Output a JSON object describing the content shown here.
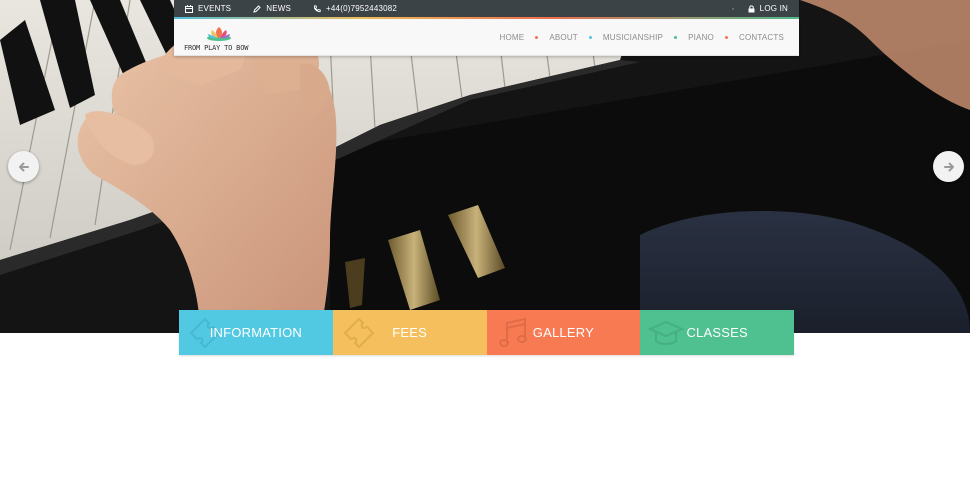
{
  "topbar": {
    "events": "EVENTS",
    "news": "NEWS",
    "phone": "+44(0)7952443082",
    "login": "LOG IN"
  },
  "logo": {
    "text": "FROM PLAY TO BOW"
  },
  "nav": {
    "items": [
      {
        "label": "HOME",
        "dot_color": "#f47351"
      },
      {
        "label": "ABOUT",
        "dot_color": "#51c4e0"
      },
      {
        "label": "MUSICIANSHIP",
        "dot_color": "#4fbf8e"
      },
      {
        "label": "PIANO",
        "dot_color": "#f47351"
      },
      {
        "label": "CONTACTS"
      }
    ]
  },
  "slider": {
    "prev_icon": "arrow-left-icon",
    "next_icon": "arrow-right-icon"
  },
  "tiles": [
    {
      "label": "INFORMATION",
      "color": "#52c9e3",
      "icon": "ticket-icon"
    },
    {
      "label": "FEES",
      "color": "#f4bf5c",
      "icon": "ticket-icon"
    },
    {
      "label": "GALLERY",
      "color": "#f77a53",
      "icon": "music-note-icon"
    },
    {
      "label": "CLASSES",
      "color": "#4fc08f",
      "icon": "graduation-cap-icon"
    }
  ]
}
